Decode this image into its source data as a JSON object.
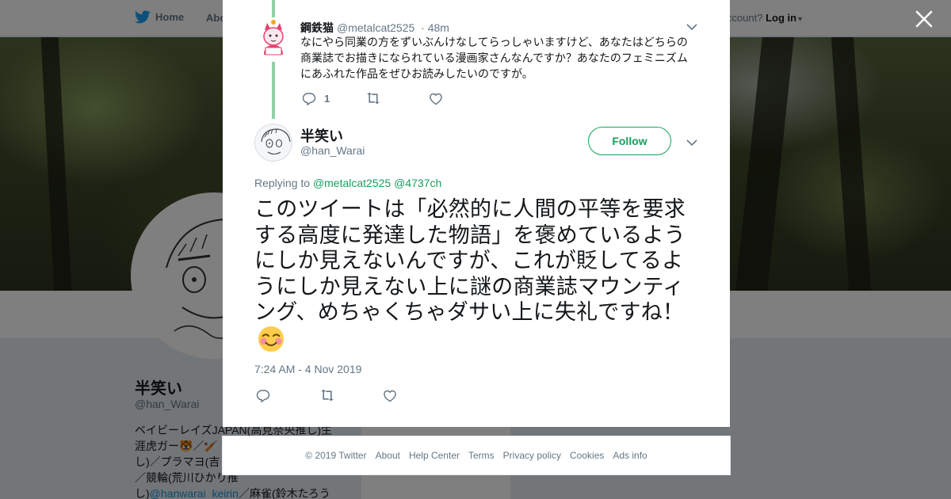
{
  "nav": {
    "home": "Home",
    "about": "Abo",
    "account_prompt": "ccount?",
    "login": "Log in"
  },
  "profile": {
    "name": "半笑い",
    "handle": "@han_Warai",
    "bio_lines": [
      "ベイビーレイズJAPAN(高見奈央推し)生",
      "涯虎ガー🐯／🏏",
      "し)／プラマヨ(吉",
      "／競輪(荒川ひかり推"
    ],
    "bio_last_prefix": "し)",
    "bio_link": "@hanwarai_keirin",
    "bio_last_suffix": "／麻雀(鈴木たろう"
  },
  "reply_tweet": {
    "name": "鋼鉄猫",
    "handle": "@metalcat2525",
    "time": "· 48m",
    "text": "なにやら同業の方をずいぶんけなしてらっしゃいますけど、あなたはどちらの商業誌でお描きになられている漫画家さんなんですか？あなたのフェミニズムにあふれた作品をぜひお読みしたいのですが。",
    "reply_count": "1",
    "retweet_count": "",
    "like_count": ""
  },
  "main_tweet": {
    "name": "半笑い",
    "handle": "@han_Warai",
    "follow_label": "Follow",
    "replying_prefix": "Replying to",
    "replying_to": "@metalcat2525 @4737ch",
    "text": "このツイートは「必然的に人間の平等を要求する高度に発達した物語」を褒めているようにしか見えないんですが、これが貶してるようにしか見えない上に謎の商業誌マウンティング、めちゃくちゃダサい上に失礼ですね！",
    "timestamp": "7:24 AM - 4 Nov 2019"
  },
  "footer": {
    "links": [
      "© 2019 Twitter",
      "About",
      "Help Center",
      "Terms",
      "Privacy policy",
      "Cookies",
      "Ads info"
    ]
  },
  "icons": {
    "close": "close-icon",
    "twitter": "twitter-bird-icon",
    "reply": "reply-icon",
    "retweet": "retweet-icon",
    "like": "heart-icon",
    "more": "chevron-down-icon"
  },
  "colors": {
    "accent_green": "#17a05d",
    "thread_line": "#8fd1a7",
    "twitter_blue": "#1da1f2",
    "muted_text": "#657786"
  }
}
